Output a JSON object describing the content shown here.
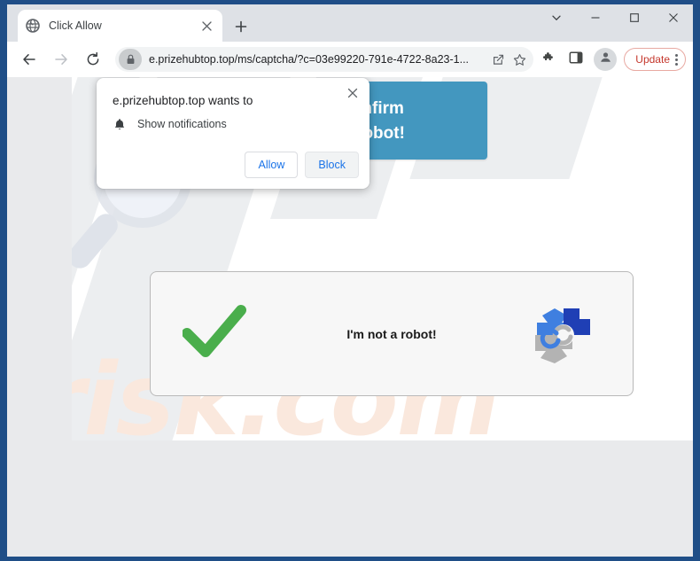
{
  "browser": {
    "tab": {
      "title": "Click Allow",
      "favicon_icon": "globe-icon",
      "close_icon": "close-icon"
    },
    "new_tab_icon": "plus-icon",
    "window_controls": {
      "tab_search_icon": "chevron-down-icon",
      "minimize_icon": "minimize-icon",
      "maximize_icon": "maximize-icon",
      "close_icon": "close-icon"
    },
    "toolbar": {
      "back_icon": "back-arrow-icon",
      "forward_icon": "forward-arrow-icon",
      "reload_icon": "reload-icon",
      "lock_icon": "lock-icon",
      "url": "e.prizehubtop.top/ms/captcha/?c=03e99220-791e-4722-8a23-1...",
      "share_icon": "share-icon",
      "bookmark_icon": "star-icon",
      "extensions_icon": "puzzle-piece-icon",
      "side_panel_icon": "side-panel-icon",
      "profile_icon": "profile-avatar-icon",
      "update_label": "Update",
      "menu_icon": "three-dot-menu-icon"
    }
  },
  "permission_popup": {
    "title": "e.prizehubtop.top wants to",
    "permission_icon": "bell-icon",
    "permission_label": "Show notifications",
    "allow_label": "Allow",
    "block_label": "Block",
    "close_icon": "close-icon"
  },
  "page": {
    "banner": {
      "line1": "to confirm",
      "line2": "ot a robot!",
      "color": "#4397bf"
    },
    "captcha": {
      "check_icon": "green-checkmark-icon",
      "label": "I'm not a robot!",
      "logo_icon": "refresh-arrows-logo-icon",
      "check_color": "#4aae4c",
      "logo_colors": {
        "light_blue": "#3f7fe0",
        "dark_blue": "#1f3fb5",
        "gray": "#b3b3b3"
      }
    },
    "watermark": {
      "text": "risk.com",
      "color": "#fae8dd",
      "glass_icon": "magnifying-glass-icon"
    }
  }
}
